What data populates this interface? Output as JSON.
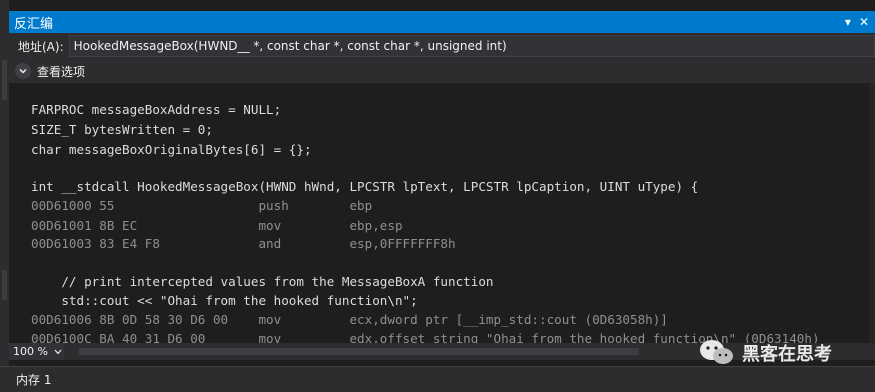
{
  "window": {
    "title": "反汇编",
    "buttons": [
      "▾",
      "✕"
    ]
  },
  "address": {
    "label": "地址(A):",
    "value": "HookedMessageBox(HWND__ *, const char *, const char *, unsigned int)"
  },
  "view_options": {
    "label": "查看选项"
  },
  "code_lines": [
    {
      "kind": "src",
      "text": "FARPROC messageBoxAddress = NULL;"
    },
    {
      "kind": "src",
      "text": "SIZE_T bytesWritten = 0;"
    },
    {
      "kind": "src",
      "text": "char messageBoxOriginalBytes[6] = {};"
    },
    {
      "kind": "blank",
      "text": ""
    },
    {
      "kind": "src",
      "text": "int __stdcall HookedMessageBox(HWND hWnd, LPCSTR lpText, LPCSTR lpCaption, UINT uType) {"
    },
    {
      "kind": "asm",
      "text": "00D61000 55                   push        ebp"
    },
    {
      "kind": "asm",
      "text": "00D61001 8B EC                mov         ebp,esp"
    },
    {
      "kind": "asm",
      "text": "00D61003 83 E4 F8             and         esp,0FFFFFFF8h"
    },
    {
      "kind": "blank",
      "text": ""
    },
    {
      "kind": "src",
      "text": "    // print intercepted values from the MessageBoxA function"
    },
    {
      "kind": "src",
      "text": "    std::cout << \"Ohai from the hooked function\\n\";"
    },
    {
      "kind": "asm",
      "text": "00D61006 8B 0D 58 30 D6 00    mov         ecx,dword ptr [__imp_std::cout (0D63058h)]"
    },
    {
      "kind": "asm",
      "text": "00D6100C BA 40 31 D6 00       mov         edx,offset string \"Ohai from the hooked function\\n\" (0D63140h)"
    }
  ],
  "zoom": {
    "value": "100 %"
  },
  "bottom_tab": {
    "label": "内存 1"
  },
  "watermark": {
    "text": "黑客在思考"
  },
  "colors": {
    "accent": "#007acc",
    "bg": "#1e1e1e",
    "source": "#dcdcdc",
    "asm": "#8f8f8f",
    "panel": "#2d2d30"
  }
}
